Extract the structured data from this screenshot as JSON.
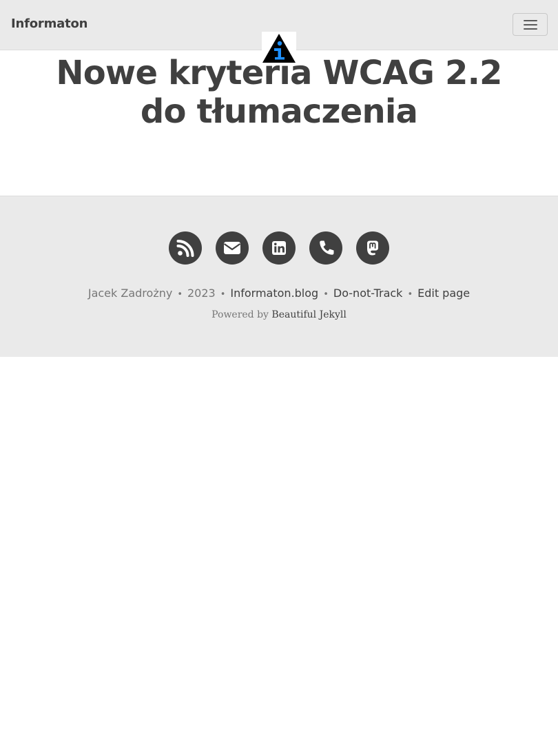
{
  "navbar": {
    "brand": "Informaton",
    "menu_icon": "hamburger-menu-icon",
    "avatar_icon": "info-triangle-logo"
  },
  "post": {
    "title_line1": "Nowe kryteria WCAG 2.2",
    "title_line2": "do tłumaczenia"
  },
  "footer": {
    "social": [
      {
        "icon": "rss-icon"
      },
      {
        "icon": "envelope-icon"
      },
      {
        "icon": "linkedin-icon"
      },
      {
        "icon": "phone-icon"
      },
      {
        "icon": "mastodon-icon"
      }
    ],
    "author": "Jacek Zadrożny",
    "year": "2023",
    "site_link": "Informaton.blog",
    "dnt_link": "Do-not-Track",
    "edit_link": "Edit page",
    "separator": "•",
    "powered_prefix": "Powered by",
    "powered_link": "Beautiful Jekyll"
  },
  "colors": {
    "text": "#404040",
    "muted": "#777777",
    "nav_bg": "#eaeaea",
    "logo_blue": "#1e90ff"
  }
}
